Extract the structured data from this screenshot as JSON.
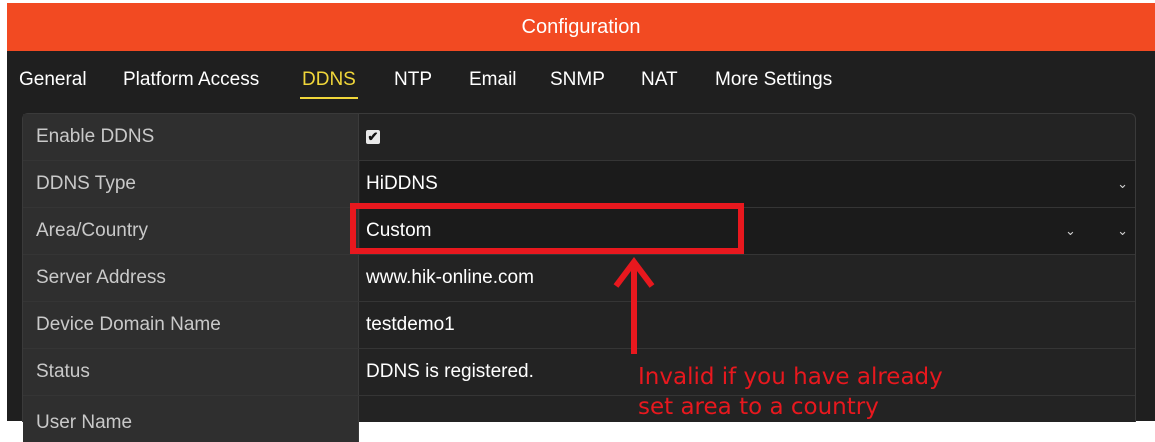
{
  "window": {
    "title": "Configuration"
  },
  "tabs": [
    {
      "label": "General",
      "active": false
    },
    {
      "label": "Platform Access",
      "active": false
    },
    {
      "label": "DDNS",
      "active": true
    },
    {
      "label": "NTP",
      "active": false
    },
    {
      "label": "Email",
      "active": false
    },
    {
      "label": "SNMP",
      "active": false
    },
    {
      "label": "NAT",
      "active": false
    },
    {
      "label": "More Settings",
      "active": false
    }
  ],
  "form": {
    "enable_ddns": {
      "label": "Enable DDNS",
      "checked": true
    },
    "ddns_type": {
      "label": "DDNS Type",
      "value": "HiDDNS",
      "icon": "chevron-down-icon"
    },
    "area_country": {
      "label": "Area/Country",
      "value": "Custom",
      "icon": "chevron-down-icon"
    },
    "server_address": {
      "label": "Server Address",
      "value": "www.hik-online.com"
    },
    "device_domain_name": {
      "label": "Device Domain Name",
      "value": "testdemo1"
    },
    "status": {
      "label": "Status",
      "value": "DDNS is registered."
    },
    "user_name": {
      "label": "User Name",
      "value": ""
    }
  },
  "annotation": {
    "line1": "Invalid if you have already",
    "line2": "set area to a country",
    "color": "#e8181e"
  },
  "colors": {
    "titlebar": "#f24a22",
    "active_tab": "#f0d63a",
    "background": "#1f1f1f"
  }
}
